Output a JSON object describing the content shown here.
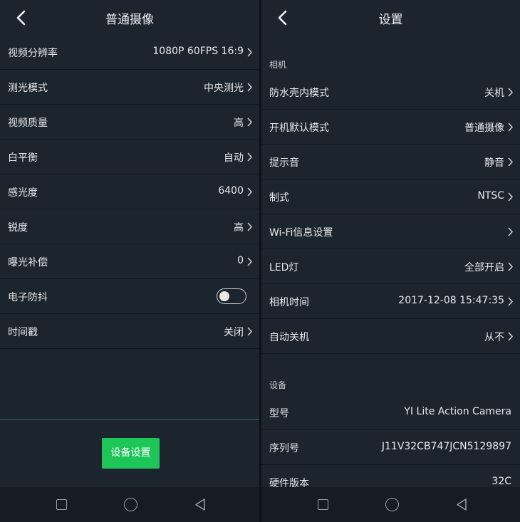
{
  "left": {
    "title": "普通摄像",
    "rows": [
      {
        "label": "视频分辨率",
        "value": "1080P 60FPS 16:9"
      },
      {
        "label": "测光模式",
        "value": "中央测光"
      },
      {
        "label": "视频质量",
        "value": "高"
      },
      {
        "label": "白平衡",
        "value": "自动"
      },
      {
        "label": "感光度",
        "value": "6400"
      },
      {
        "label": "锐度",
        "value": "高"
      },
      {
        "label": "曝光补偿",
        "value": "0"
      },
      {
        "label": "电子防抖",
        "toggle_on": false
      },
      {
        "label": "时间戳",
        "value": "关闭"
      }
    ],
    "button_label": "设备设置"
  },
  "right": {
    "title": "设置",
    "section_camera": "相机",
    "camera_rows": [
      {
        "label": "防水壳内模式",
        "value": "关机"
      },
      {
        "label": "开机默认模式",
        "value": "普通摄像"
      },
      {
        "label": "提示音",
        "value": "静音"
      },
      {
        "label": "制式",
        "value": "NTSC"
      },
      {
        "label": "Wi-Fi信息设置",
        "value": ""
      },
      {
        "label": "LED灯",
        "value": "全部开启"
      },
      {
        "label": "相机时间",
        "value": "2017-12-08 15:47:35"
      },
      {
        "label": "自动关机",
        "value": "从不"
      }
    ],
    "section_device": "设备",
    "device_rows": [
      {
        "label": "型号",
        "value": "YI Lite Action Camera"
      },
      {
        "label": "序列号",
        "value": "J11V32CB747JCN5129897"
      },
      {
        "label": "硬件版本",
        "value": "32C"
      }
    ]
  },
  "icons": {
    "back": "chevron-left-icon",
    "row_arrow": "chevron-right-icon",
    "nav_recent": "square-icon",
    "nav_home": "circle-icon",
    "nav_back": "triangle-back-icon"
  },
  "colors": {
    "background": "#1c242e",
    "accent_green": "#1ec65a",
    "divider": "#111820"
  }
}
